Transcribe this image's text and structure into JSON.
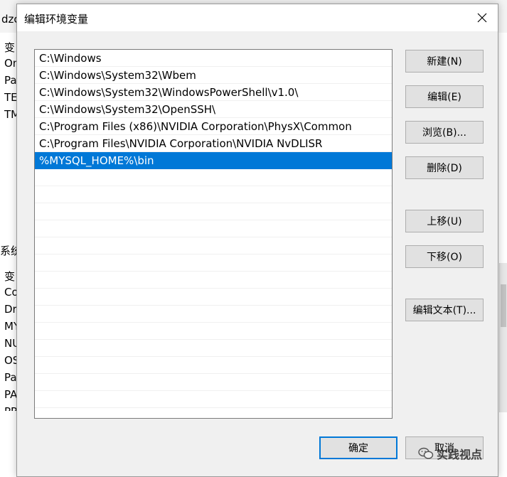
{
  "background": {
    "title_fragment": "dzcy",
    "upper_rows": [
      "变",
      "On",
      "Pa",
      "TE",
      "TM"
    ],
    "section_label": "系统",
    "lower_rows": [
      "变",
      "Co",
      "Dr",
      "MY",
      "NU",
      "OS",
      "Pa",
      "PA",
      "PR"
    ]
  },
  "dialog": {
    "title": "编辑环境变量",
    "paths": [
      "C:\\Windows",
      "C:\\Windows\\System32\\Wbem",
      "C:\\Windows\\System32\\WindowsPowerShell\\v1.0\\",
      "C:\\Windows\\System32\\OpenSSH\\",
      "C:\\Program Files (x86)\\NVIDIA Corporation\\PhysX\\Common",
      "C:\\Program Files\\NVIDIA Corporation\\NVIDIA NvDLISR",
      "%MYSQL_HOME%\\bin"
    ],
    "selected_index": 6,
    "buttons": {
      "new": "新建(N)",
      "edit": "编辑(E)",
      "browse": "浏览(B)...",
      "delete": "删除(D)",
      "move_up": "上移(U)",
      "move_down": "下移(O)",
      "edit_text": "编辑文本(T)..."
    },
    "ok": "确定",
    "cancel": "取消"
  },
  "watermark": "实践视点",
  "colors": {
    "selection": "#0078d7",
    "dialog_bg": "#f0f0f0",
    "button_bg": "#e1e1e1"
  }
}
